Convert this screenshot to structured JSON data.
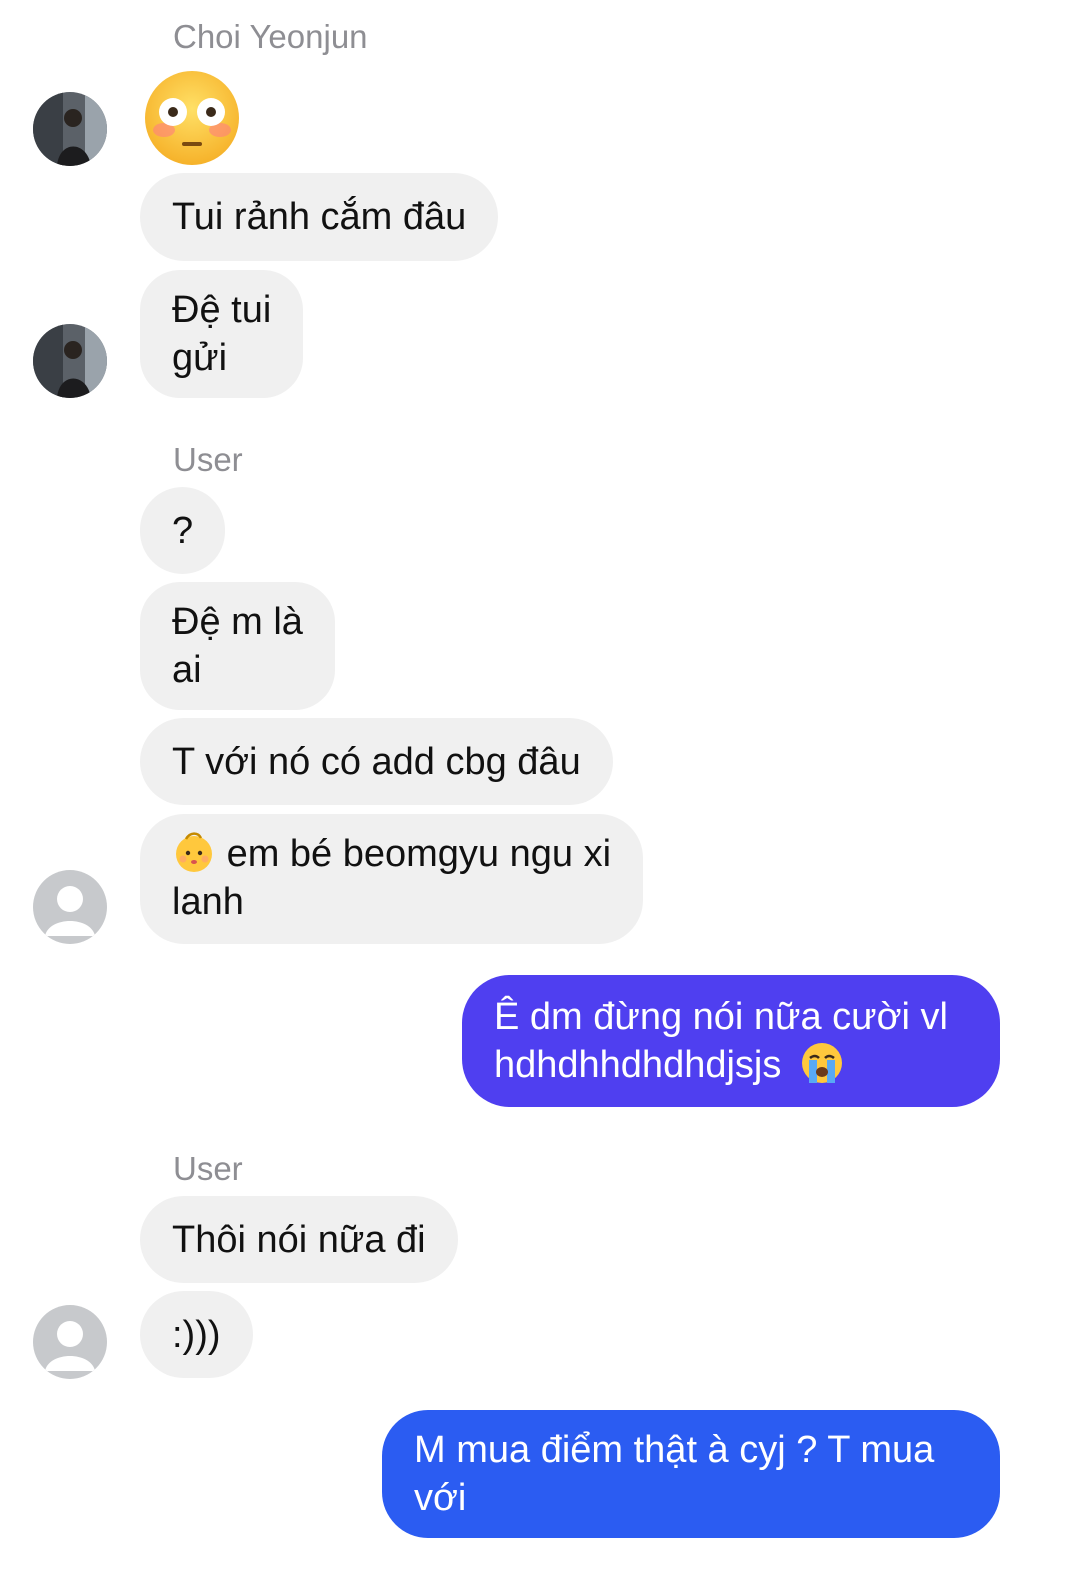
{
  "conversation": {
    "groups": [
      {
        "sender": "Choi Yeonjun",
        "emoji": "flushed-face",
        "messages": [
          "Tui rảnh cắm đâu",
          "Đệ tui\ngửi"
        ]
      },
      {
        "sender": "User",
        "messages": [
          "?",
          "Đệ m là\nai",
          "T với nó có add cbg đâu",
          "em bé beomgyu ngu xi\nlanh"
        ]
      },
      {
        "sender": "User",
        "messages": [
          "Thôi nói nữa đi",
          ":)))"
        ]
      }
    ],
    "outgoing": [
      "Ê dm đừng nói nữa cười vl\nhdhdhhdhdhdjsjs",
      "M mua điểm thật à cyj ? T mua\nvới"
    ]
  },
  "colors": {
    "incoming_bubble": "#f0f0f0",
    "outgoing_bubble_1": "#4f3ff0",
    "outgoing_bubble_2": "#2b5cf2",
    "sender_name": "#8e8e93"
  },
  "icons": {
    "emoji_1": "flushed-face",
    "emoji_2": "baby",
    "emoji_3": "loudly-crying-face",
    "avatar_photo": "profile-photo",
    "avatar_default": "default-user-avatar"
  }
}
